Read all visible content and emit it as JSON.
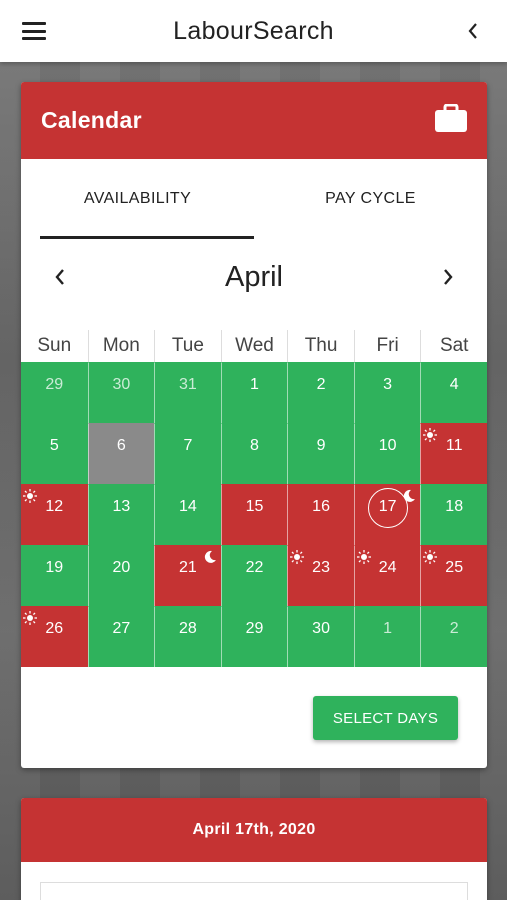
{
  "app": {
    "title": "LabourSearch"
  },
  "calendar_card": {
    "title": "Calendar",
    "icon": "briefcase-icon",
    "tabs": [
      {
        "label": "AVAILABILITY",
        "active": true
      },
      {
        "label": "PAY CYCLE",
        "active": false
      }
    ],
    "month": "April",
    "weekdays": [
      "Sun",
      "Mon",
      "Tue",
      "Wed",
      "Thu",
      "Fri",
      "Sat"
    ],
    "days": [
      {
        "n": "29",
        "status": "green",
        "other": true
      },
      {
        "n": "30",
        "status": "green",
        "other": true
      },
      {
        "n": "31",
        "status": "green",
        "other": true
      },
      {
        "n": "1",
        "status": "green"
      },
      {
        "n": "2",
        "status": "green"
      },
      {
        "n": "3",
        "status": "green"
      },
      {
        "n": "4",
        "status": "green"
      },
      {
        "n": "5",
        "status": "green"
      },
      {
        "n": "6",
        "status": "grey"
      },
      {
        "n": "7",
        "status": "green"
      },
      {
        "n": "8",
        "status": "green"
      },
      {
        "n": "9",
        "status": "green"
      },
      {
        "n": "10",
        "status": "green"
      },
      {
        "n": "11",
        "status": "red",
        "icon": "sun"
      },
      {
        "n": "12",
        "status": "red",
        "icon": "sun"
      },
      {
        "n": "13",
        "status": "green"
      },
      {
        "n": "14",
        "status": "green"
      },
      {
        "n": "15",
        "status": "red"
      },
      {
        "n": "16",
        "status": "red"
      },
      {
        "n": "17",
        "status": "red",
        "icon": "moon",
        "today": true
      },
      {
        "n": "18",
        "status": "green"
      },
      {
        "n": "19",
        "status": "green"
      },
      {
        "n": "20",
        "status": "green"
      },
      {
        "n": "21",
        "status": "red",
        "icon": "moon"
      },
      {
        "n": "22",
        "status": "green"
      },
      {
        "n": "23",
        "status": "red",
        "icon": "sun"
      },
      {
        "n": "24",
        "status": "red",
        "icon": "sun"
      },
      {
        "n": "25",
        "status": "red",
        "icon": "sun"
      },
      {
        "n": "26",
        "status": "red",
        "icon": "sun"
      },
      {
        "n": "27",
        "status": "green"
      },
      {
        "n": "28",
        "status": "green"
      },
      {
        "n": "29",
        "status": "green"
      },
      {
        "n": "30",
        "status": "green"
      },
      {
        "n": "1",
        "status": "green",
        "other": true
      },
      {
        "n": "2",
        "status": "green",
        "other": true
      }
    ],
    "select_button": "SELECT DAYS"
  },
  "detail_card": {
    "title": "April 17th, 2020"
  },
  "colors": {
    "red": "#c53333",
    "green": "#2fb25c",
    "grey": "#8a8a8a"
  }
}
